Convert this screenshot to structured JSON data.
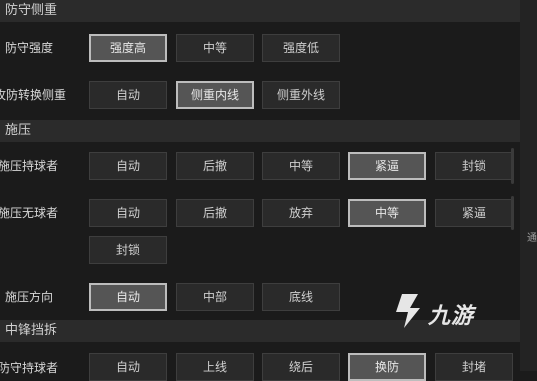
{
  "sections": [
    {
      "title": "防守侧重"
    },
    {
      "title": "施压"
    },
    {
      "title": "中锋挡拆"
    }
  ],
  "rows": {
    "defense_strength": {
      "label": "防守强度",
      "options": [
        "强度高",
        "中等",
        "强度低"
      ],
      "selected": 0
    },
    "switch_focus": {
      "label": "攻防转换侧重",
      "options": [
        "自动",
        "侧重内线",
        "侧重外线"
      ],
      "selected": 1
    },
    "press_ball_holder": {
      "label": "施压持球者",
      "options": [
        "自动",
        "后撤",
        "中等",
        "紧逼",
        "封锁"
      ],
      "selected": 3
    },
    "press_off_ball": {
      "label": "施压无球者",
      "options": [
        "自动",
        "后撤",
        "放弃",
        "中等",
        "紧逼",
        "封锁"
      ],
      "selected": 3
    },
    "press_direction": {
      "label": "施压方向",
      "options": [
        "自动",
        "中部",
        "底线"
      ],
      "selected": 0
    },
    "pnr_ball_holder": {
      "label": "防守持球者",
      "options": [
        "自动",
        "上线",
        "绕后",
        "换防",
        "封堵"
      ],
      "selected": 3
    }
  },
  "right_panel": {
    "text": "通"
  },
  "watermark": {
    "text": "九游",
    "icon": "jiuyou-logo-icon"
  }
}
